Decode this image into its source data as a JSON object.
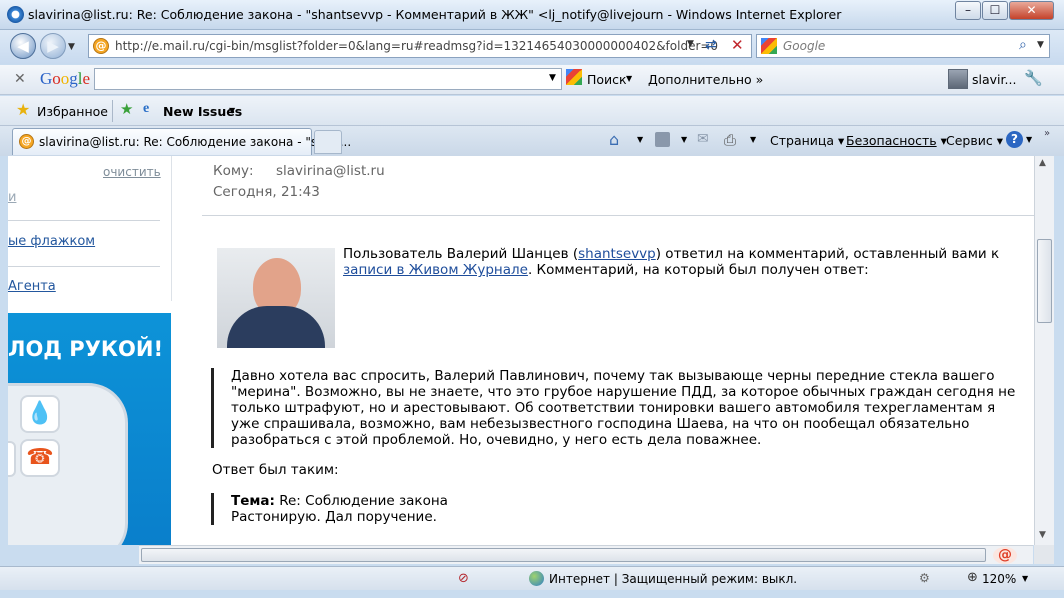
{
  "window": {
    "title": "slavirina@list.ru: Re: Соблюдение закона - \"shantsevvp - Комментарий в ЖЖ\" <lj_notify@livejourn - Windows Internet Explorer",
    "minimize": "–",
    "maximize": "☐",
    "close": "✕"
  },
  "address": {
    "url": "http://e.mail.ru/cgi-bin/msglist?folder=0&lang=ru#readmsg?id=13214654030000000402&folder=0",
    "search_placeholder": "Google"
  },
  "google_toolbar": {
    "logo": "Google",
    "search_label": "Поиск",
    "more_label": "Дополнительно »",
    "user": "slavir..."
  },
  "favorites": {
    "label": "Избранное",
    "new_issues": "New Issues"
  },
  "tab": {
    "label": "slavirina@list.ru: Re: Соблюдение закона - \"shan..."
  },
  "commandbar": {
    "page": "Страница",
    "safety": "Безопасность",
    "tools": "Сервис"
  },
  "left_pane": {
    "clear": "очистить",
    "item_partial": "и",
    "flagged": "ые флажком",
    "agent": "Агента",
    "banner_text": "ЛОД РУКОЙ!"
  },
  "message": {
    "to_label": "Кому:",
    "to_value": "slavirina@list.ru",
    "date": "Сегодня, 21:43",
    "intro_pre": "Пользователь Валерий Шанцев (",
    "intro_link_user": "shantsevvp",
    "intro_mid": ") ответил на комментарий, оставленный вами к ",
    "intro_link_entry": "записи в Живом Журнале",
    "intro_post": ". Комментарий, на который был получен ответ:",
    "quote": "Давно хотела вас спросить, Валерий Павлинович, почему так вызывающе черны передние стекла вашего \"мерина\". Возможно, вы не знаете, что это грубое нарушение ПДД, за которое обычных граждан сегодня не только штрафуют, но и арестовывают. Об соответствии тонировки вашего автомобиля техрегламентам я уже спрашивала, возможно, вам небезызвестного господина Шаева, на что он пообещал обязательно разобраться с этой проблемой. Но, очевидно, у него есть дела поважнее.",
    "answer_intro": "Ответ был таким:",
    "reply_subject_label": "Тема:",
    "reply_subject": "Re: Соблюдение закона",
    "reply_body": "Растонирую. Дал поручение."
  },
  "statusbar": {
    "zone": "Интернет | Защищенный режим: выкл.",
    "zoom": "120%"
  },
  "colors": {
    "link": "#1e4d9b",
    "banner": "#0d93d8",
    "chrome": "#c9dcef"
  }
}
